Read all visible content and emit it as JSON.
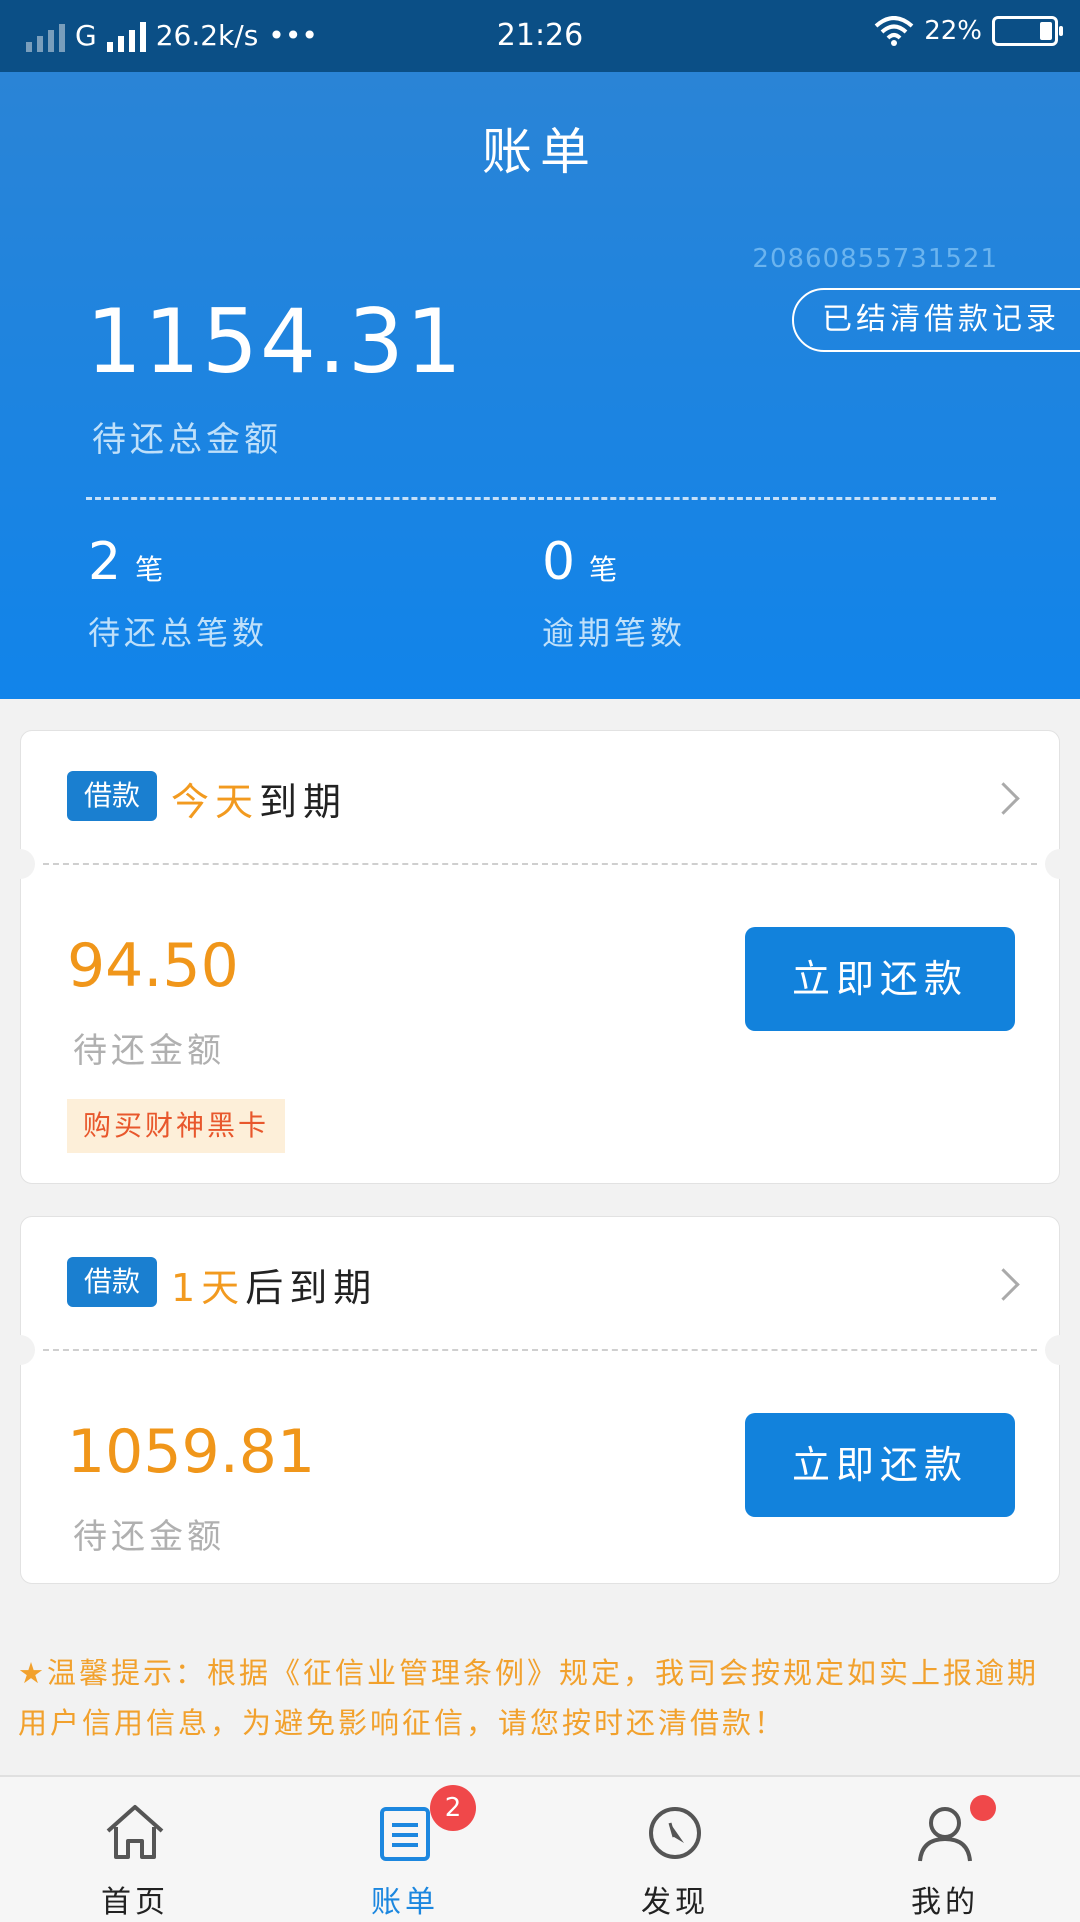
{
  "status_bar": {
    "carrier": "G",
    "net_speed": "26.2k/s",
    "more": "•••",
    "time": "21:26",
    "battery": "22%"
  },
  "header": {
    "title": "账单",
    "serial": "20860855731521",
    "history_button": "已结清借款记录",
    "total_amount": "1154.31",
    "total_amount_label": "待还总金额",
    "stats": [
      {
        "value": "2",
        "unit": "笔",
        "label": "待还总笔数"
      },
      {
        "value": "0",
        "unit": "笔",
        "label": "逾期笔数"
      }
    ]
  },
  "bills": [
    {
      "tag": "借款",
      "due_highlight": "今天",
      "due_text": "到期",
      "amount": "94.50",
      "amount_label": "待还金额",
      "pay_button": "立即还款",
      "promo": "购买财神黑卡"
    },
    {
      "tag": "借款",
      "due_highlight": "1天",
      "due_text": "后到期",
      "amount": "1059.81",
      "amount_label": "待还金额",
      "pay_button": "立即还款"
    }
  ],
  "notice": "★温馨提示：根据《征信业管理条例》规定，我司会按规定如实上报逾期用户信用信息，为避免影响征信，请您按时还清借款！",
  "bottom_nav": [
    {
      "label": "首页",
      "icon": "home-icon"
    },
    {
      "label": "账单",
      "icon": "bill-icon",
      "badge": "2",
      "active": true
    },
    {
      "label": "发现",
      "icon": "compass-icon"
    },
    {
      "label": "我的",
      "icon": "user-icon",
      "dot": true
    }
  ],
  "colors": {
    "header_blue": "#1184ea",
    "status_bar": "#0b4f86",
    "orange": "#f0961a",
    "button_blue": "#1282dc",
    "badge_red": "#f0484a"
  }
}
